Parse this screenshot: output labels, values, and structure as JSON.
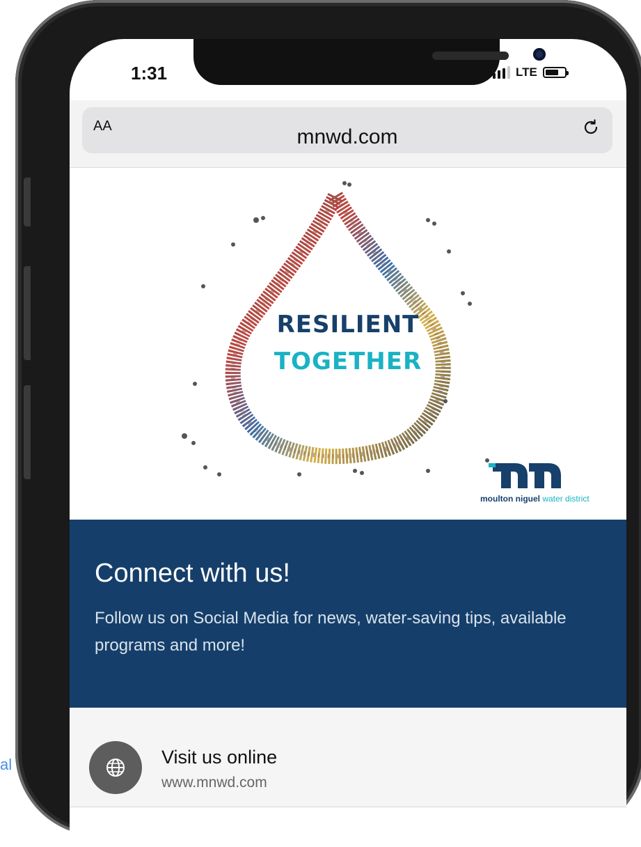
{
  "status_bar": {
    "time": "1:31",
    "network": "LTE"
  },
  "browser": {
    "text_size_label": "AA",
    "url": "mnwd.com"
  },
  "hero": {
    "headline_line1": "RESILIENT",
    "headline_line2": "TOGETHER",
    "logo_name_bold": "moulton niguel",
    "logo_name_rest": "water district"
  },
  "connect": {
    "title": "Connect with us!",
    "body": "Follow us on Social Media for news, water-saving tips, available programs and more!"
  },
  "links": [
    {
      "title": "Visit us online",
      "subtitle": "www.mnwd.com",
      "icon": "globe-icon"
    }
  ],
  "stray_text": "al",
  "colors": {
    "brand_navy": "#153f6a",
    "brand_teal": "#1ab2c4"
  }
}
